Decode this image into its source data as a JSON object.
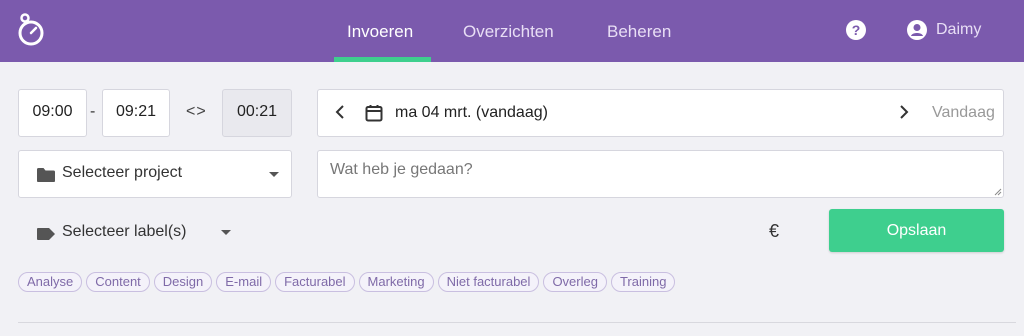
{
  "nav": {
    "items": [
      {
        "label": "Invoeren",
        "active": true
      },
      {
        "label": "Overzichten",
        "active": false
      },
      {
        "label": "Beheren",
        "active": false
      }
    ],
    "help_label": "?",
    "user_name": "Daimy",
    "icons": {
      "logo": "stopwatch-icon",
      "help": "help-icon",
      "user": "user-circle-icon"
    }
  },
  "time": {
    "start": "09:00",
    "separator": "-",
    "end": "09:21",
    "swap_label": "<>",
    "duration": "00:21"
  },
  "date": {
    "label": "ma 04 mrt. (vandaag)",
    "today_label": "Vandaag"
  },
  "project": {
    "placeholder": "Selecteer project"
  },
  "description": {
    "placeholder": "Wat heb je gedaan?",
    "value": ""
  },
  "labels": {
    "placeholder": "Selecteer label(s)",
    "chips": [
      "Analyse",
      "Content",
      "Design",
      "E-mail",
      "Facturabel",
      "Marketing",
      "Niet facturabel",
      "Overleg",
      "Training"
    ]
  },
  "billing": {
    "currency_symbol": "€"
  },
  "save_label": "Opslaan",
  "colors": {
    "header": "#7b5aad",
    "accent": "#3ecf8e",
    "chip_text": "#7f6aa8"
  }
}
